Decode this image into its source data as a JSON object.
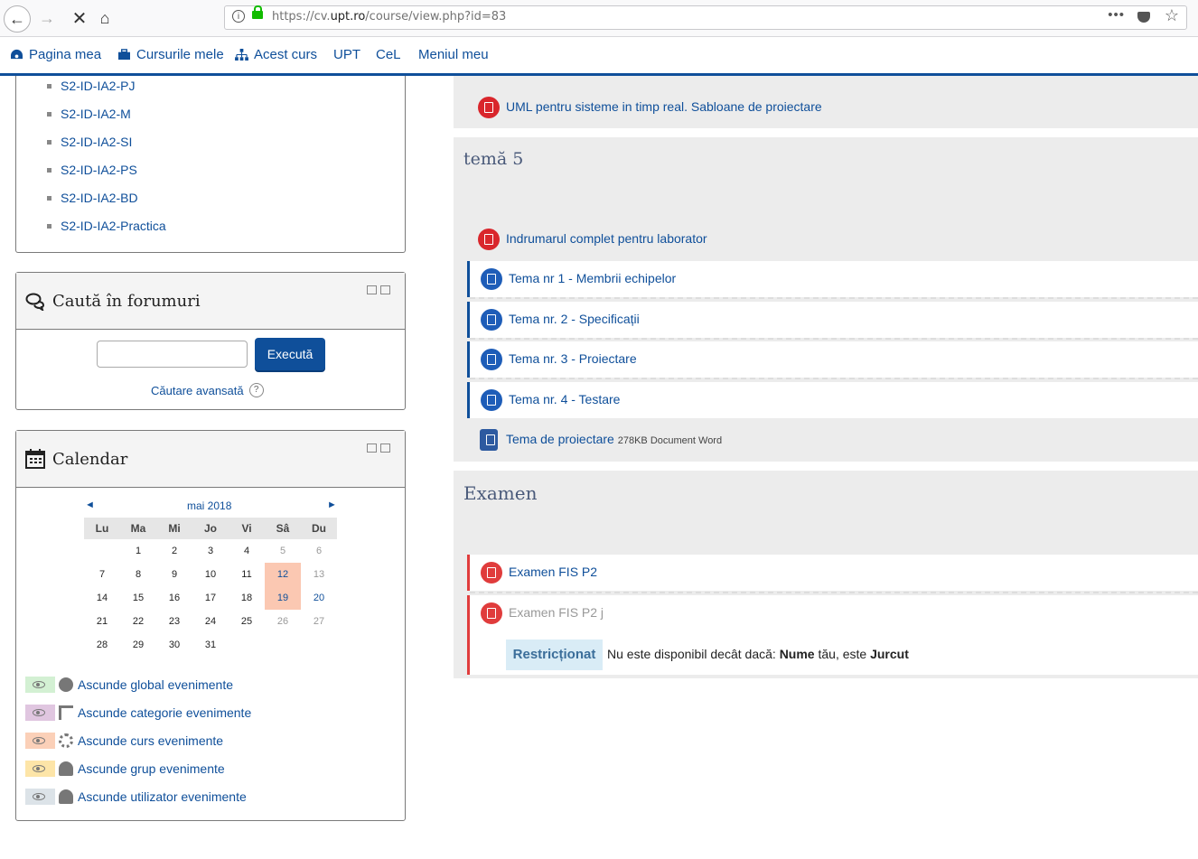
{
  "browser": {
    "url_prefix": "https://cv.",
    "url_domain": "upt.ro",
    "url_path": "/course/view.php?id=83",
    "menu_dots": "•••"
  },
  "navbar": {
    "items": [
      "Pagina mea",
      "Cursurile mele",
      "Acest curs",
      "UPT",
      "CeL",
      "Meniul meu"
    ]
  },
  "courses": [
    "S2-ID-IA2-PJ",
    "S2-ID-IA2-M",
    "S2-ID-IA2-SI",
    "S2-ID-IA2-PS",
    "S2-ID-IA2-BD",
    "S2-ID-IA2-Practica"
  ],
  "search_block": {
    "title": "Caută în forumuri",
    "button": "Execută",
    "advanced": "Căutare avansată",
    "help": "?"
  },
  "calendar": {
    "title": "Calendar",
    "month": "mai 2018",
    "prev": "◄",
    "next": "►",
    "days": [
      "Lu",
      "Ma",
      "Mi",
      "Jo",
      "Vi",
      "Sâ",
      "Du"
    ],
    "weeks": [
      [
        "",
        "1",
        "2",
        "3",
        "4",
        "5",
        "6"
      ],
      [
        "7",
        "8",
        "9",
        "10",
        "11",
        "12",
        "13"
      ],
      [
        "14",
        "15",
        "16",
        "17",
        "18",
        "19",
        "20"
      ],
      [
        "21",
        "22",
        "23",
        "24",
        "25",
        "26",
        "27"
      ],
      [
        "28",
        "29",
        "30",
        "31",
        "",
        "",
        ""
      ]
    ],
    "legend": [
      {
        "label": "Ascunde global evenimente",
        "color": "#d3f0d3"
      },
      {
        "label": "Ascunde categorie evenimente",
        "color": "#e0c6e0"
      },
      {
        "label": "Ascunde curs evenimente",
        "color": "#fbd0b8"
      },
      {
        "label": "Ascunde grup evenimente",
        "color": "#fde5a8"
      },
      {
        "label": "Ascunde utilizator evenimente",
        "color": "#dce3e8"
      }
    ]
  },
  "main": {
    "top_activity": "UML pentru sisteme in timp real. Sabloane de proiectare",
    "section5": {
      "title": "temă 5",
      "activities": [
        "Indrumarul complet pentru laborator",
        "Tema nr 1 - Membrii echipelor",
        "Tema nr. 2 - Specificații",
        "Tema nr. 3 - Proiectare",
        "Tema nr. 4 - Testare",
        "Tema de proiectare"
      ],
      "file_info": "278KB Document Word"
    },
    "exam": {
      "title": "Examen",
      "activities": [
        "Examen FIS P2",
        "Examen FIS P2 j"
      ],
      "restricted_badge": "Restricționat",
      "restriction_prefix": "Nu este disponibil decât dacă: ",
      "restriction_field": "Nume",
      "restriction_mid": " tău, este ",
      "restriction_value": "Jurcut"
    }
  }
}
